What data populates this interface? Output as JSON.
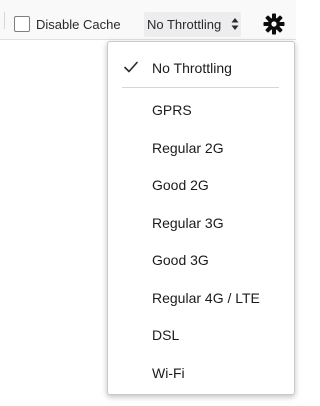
{
  "toolbar": {
    "disable_cache_label": "Disable Cache",
    "disable_cache_checked": false,
    "throttle_selected": "No Throttling"
  },
  "throttle_menu": {
    "items": [
      {
        "label": "No Throttling",
        "checked": true
      },
      {
        "label": "GPRS",
        "checked": false
      },
      {
        "label": "Regular 2G",
        "checked": false
      },
      {
        "label": "Good 2G",
        "checked": false
      },
      {
        "label": "Regular 3G",
        "checked": false
      },
      {
        "label": "Good 3G",
        "checked": false
      },
      {
        "label": "Regular 4G / LTE",
        "checked": false
      },
      {
        "label": "DSL",
        "checked": false
      },
      {
        "label": "Wi-Fi",
        "checked": false
      }
    ]
  },
  "icons": {
    "settings": "gear-icon",
    "checkmark": "checkmark-icon",
    "select_arrows": "updown-arrows-icon"
  }
}
